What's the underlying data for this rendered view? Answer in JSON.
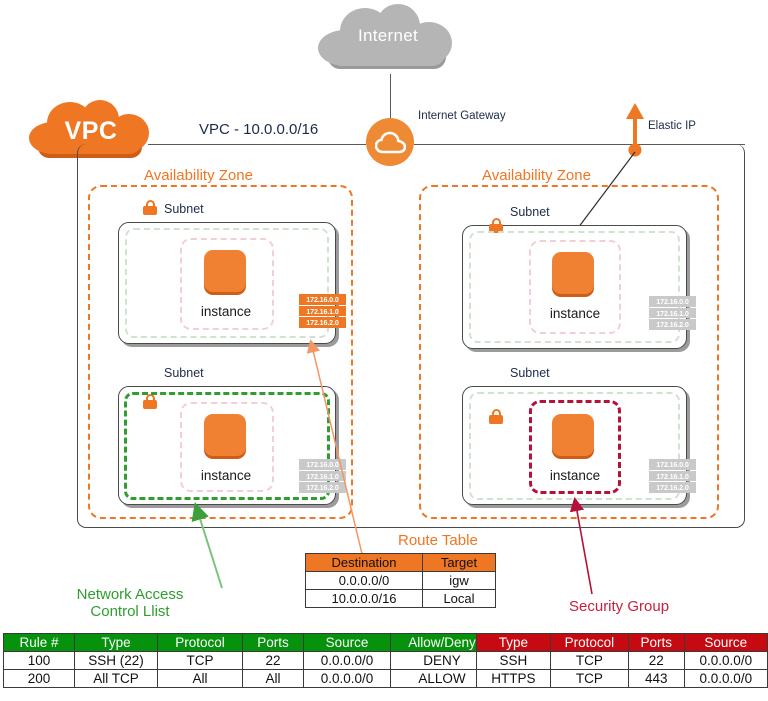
{
  "diagram": {
    "internet": {
      "label": "Internet"
    },
    "vpc": {
      "logo_label": "VPC",
      "cidr_label": "VPC - 10.0.0.0/16"
    },
    "internet_gateway": {
      "label": "Internet Gateway",
      "icon": "cloud-circle-icon"
    },
    "elastic_ip": {
      "label": "Elastic IP",
      "icon": "up-arrow-icon"
    },
    "availability_zones": [
      {
        "label": "Availability Zone"
      },
      {
        "label": "Availability Zone"
      }
    ],
    "subnets": [
      {
        "label": "Subnet",
        "instance_label": "instance",
        "ip_addresses": [
          "172.16.0.0",
          "172.16.1.0",
          "172.16.2.0"
        ],
        "ip_highlight": true,
        "nacl_highlight": false,
        "sg_highlight": false
      },
      {
        "label": "Subnet",
        "instance_label": "instance",
        "ip_addresses": [
          "172.16.0.0",
          "172.16.1.0",
          "172.16.2.0"
        ],
        "ip_highlight": false,
        "nacl_highlight": false,
        "sg_highlight": false
      },
      {
        "label": "Subnet",
        "instance_label": "instance",
        "ip_addresses": [
          "172.16.0.0",
          "172.16.1.0",
          "172.16.2.0"
        ],
        "ip_highlight": false,
        "nacl_highlight": true,
        "sg_highlight": false
      },
      {
        "label": "Subnet",
        "instance_label": "instance",
        "ip_addresses": [
          "172.16.0.0",
          "172.16.1.0",
          "172.16.2.0"
        ],
        "ip_highlight": false,
        "nacl_highlight": false,
        "sg_highlight": true
      }
    ],
    "route_table": {
      "title": "Route Table",
      "headers": [
        "Destination",
        "Target"
      ],
      "rows": [
        [
          "0.0.0.0/0",
          "igw"
        ],
        [
          "10.0.0.0/16",
          "Local"
        ]
      ]
    },
    "nacl": {
      "title_line1": "Network Access",
      "title_line2": "Control Llist",
      "headers": [
        "Rule #",
        "Type",
        "Protocol",
        "Ports",
        "Source",
        "Allow/Deny"
      ],
      "rows": [
        [
          "100",
          "SSH (22)",
          "TCP",
          "22",
          "0.0.0.0/0",
          "DENY"
        ],
        [
          "200",
          "All TCP",
          "All",
          "All",
          "0.0.0.0/0",
          "ALLOW"
        ]
      ]
    },
    "security_group": {
      "title": "Security Group",
      "headers": [
        "Type",
        "Protocol",
        "Ports",
        "Source"
      ],
      "rows": [
        [
          "SSH",
          "TCP",
          "22",
          "0.0.0.0/0"
        ],
        [
          "HTTPS",
          "TCP",
          "443",
          "0.0.0.0/0"
        ]
      ]
    },
    "colors": {
      "aws_orange": "#ef7622",
      "instance_orange": "#f08133",
      "internet_grey": "#b0b0b0",
      "nacl_green": "#2f9e2f",
      "nacl_header_green": "#07920d",
      "sg_red": "#b3123a",
      "sg_header_red": "#c50a12",
      "line_grey": "#595959"
    }
  }
}
